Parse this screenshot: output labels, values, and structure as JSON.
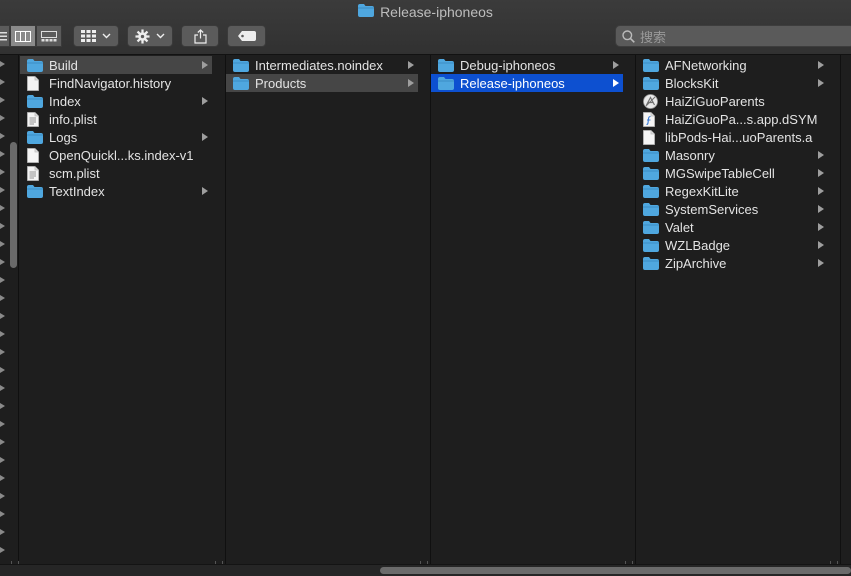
{
  "window": {
    "title": "Release-iphoneos"
  },
  "toolbar": {
    "search_placeholder": "搜索"
  },
  "columns": [
    {
      "items": [
        {
          "label": "Build",
          "icon": "folder",
          "arrow": true,
          "selected": "gray"
        },
        {
          "label": "FindNavigator.history",
          "icon": "file",
          "arrow": false
        },
        {
          "label": "Index",
          "icon": "folder",
          "arrow": true
        },
        {
          "label": "info.plist",
          "icon": "plist",
          "arrow": false
        },
        {
          "label": "Logs",
          "icon": "folder",
          "arrow": true
        },
        {
          "label": "OpenQuickl...ks.index-v1",
          "icon": "file",
          "arrow": false
        },
        {
          "label": "scm.plist",
          "icon": "plist",
          "arrow": false
        },
        {
          "label": "TextIndex",
          "icon": "folder",
          "arrow": true
        }
      ]
    },
    {
      "items": [
        {
          "label": "Intermediates.noindex",
          "icon": "folder",
          "arrow": true
        },
        {
          "label": "Products",
          "icon": "folder",
          "arrow": true,
          "selected": "gray"
        }
      ]
    },
    {
      "items": [
        {
          "label": "Debug-iphoneos",
          "icon": "folder",
          "arrow": true
        },
        {
          "label": "Release-iphoneos",
          "icon": "folder",
          "arrow": true,
          "selected": "blue"
        }
      ]
    },
    {
      "items": [
        {
          "label": "AFNetworking",
          "icon": "folder",
          "arrow": true
        },
        {
          "label": "BlocksKit",
          "icon": "folder",
          "arrow": true
        },
        {
          "label": "HaiZiGuoParents",
          "icon": "app",
          "arrow": false
        },
        {
          "label": "HaiZiGuoPa...s.app.dSYM",
          "icon": "dsym",
          "arrow": false
        },
        {
          "label": "libPods-Hai...uoParents.a",
          "icon": "file",
          "arrow": false
        },
        {
          "label": "Masonry",
          "icon": "folder",
          "arrow": true
        },
        {
          "label": "MGSwipeTableCell",
          "icon": "folder",
          "arrow": true
        },
        {
          "label": "RegexKitLite",
          "icon": "folder",
          "arrow": true
        },
        {
          "label": "SystemServices",
          "icon": "folder",
          "arrow": true
        },
        {
          "label": "Valet",
          "icon": "folder",
          "arrow": true
        },
        {
          "label": "WZLBadge",
          "icon": "folder",
          "arrow": true
        },
        {
          "label": "ZipArchive",
          "icon": "folder",
          "arrow": true
        }
      ]
    }
  ],
  "colors": {
    "accent_selection": "#0d50d0",
    "gray_selection": "#464646",
    "folder": "#4fa7df"
  }
}
